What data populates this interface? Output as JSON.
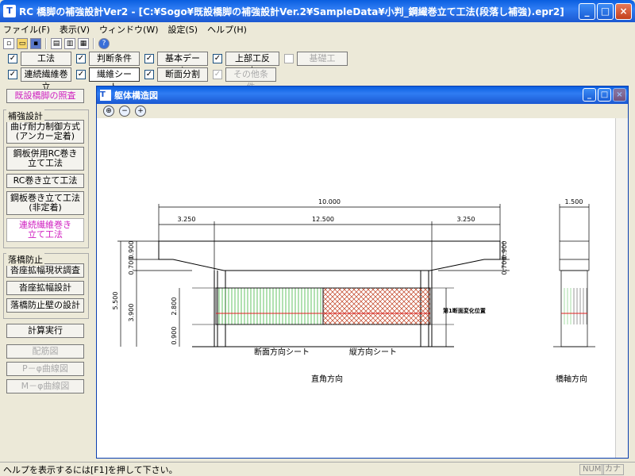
{
  "window": {
    "title": "RC 橋脚の補強設計Ver2 - [C:¥Sogo¥既設橋脚の補強設計Ver.2¥SampleData¥小判_鋼繊巻立て工法(段落し補強).epr2]",
    "app_icon": "T"
  },
  "menu": [
    "ファイル(F)",
    "表示(V)",
    "ウィンドウ(W)",
    "設定(S)",
    "ヘルプ(H)"
  ],
  "options_row1": [
    {
      "label": "工法",
      "checked": true,
      "disabled": false
    },
    {
      "label": "判断条件",
      "checked": true,
      "disabled": false
    },
    {
      "label": "基本データ",
      "checked": true,
      "disabled": false
    },
    {
      "label": "上部工反力",
      "checked": true,
      "disabled": false
    },
    {
      "label": "基礎工",
      "checked": false,
      "disabled": true
    }
  ],
  "options_row2": [
    {
      "label": "連続繊維巻立",
      "checked": true,
      "disabled": false
    },
    {
      "label": "繊維シート",
      "checked": true,
      "disabled": false
    },
    {
      "label": "断面分割",
      "checked": true,
      "disabled": false
    },
    {
      "label": "その他条件",
      "checked": true,
      "disabled": true
    }
  ],
  "left": {
    "top_button": "既設橋脚の照査",
    "group1_label": "補強設計",
    "group1": [
      "曲げ耐力制御方式\n(アンカー定着)",
      "鋼板併用RC巻き\n立て工法",
      "RC巻き立て工法",
      "鋼板巻き立て工法\n(非定着)",
      "連続繊維巻き\n立て工法"
    ],
    "group2_label": "落橋防止",
    "group2": [
      "沓座拡幅現状調査",
      "沓座拡幅設計",
      "落橋防止壁の設計"
    ],
    "calc": "計算実行",
    "disabled": [
      "配筋図",
      "P－φ曲線図",
      "M－φ曲線図"
    ]
  },
  "mdi": {
    "title": "躯体構造図"
  },
  "drawing": {
    "dim_total": "10.000",
    "dim_left": "3.250",
    "dim_mid": "12.500",
    "dim_right": "3.250",
    "dim_side_top": "1.500",
    "v_5500": "5.500",
    "v_3900": "3.900",
    "v_0900a": "0.900",
    "v_0700": "0.700",
    "v_2800": "2.800",
    "v_0900b": "0.900",
    "vr_0900": "0.900",
    "vr_0700": "0.700",
    "label_section_change": "第1断面変化位置",
    "label_sheet_cross": "断面方向シート",
    "label_sheet_vert": "縦方向シート",
    "label_front": "直角方向",
    "label_side": "橋軸方向"
  },
  "status": {
    "text": "ヘルプを表示するには[F1]を押して下さい。",
    "num": "NUM",
    "kana": "カナ"
  }
}
